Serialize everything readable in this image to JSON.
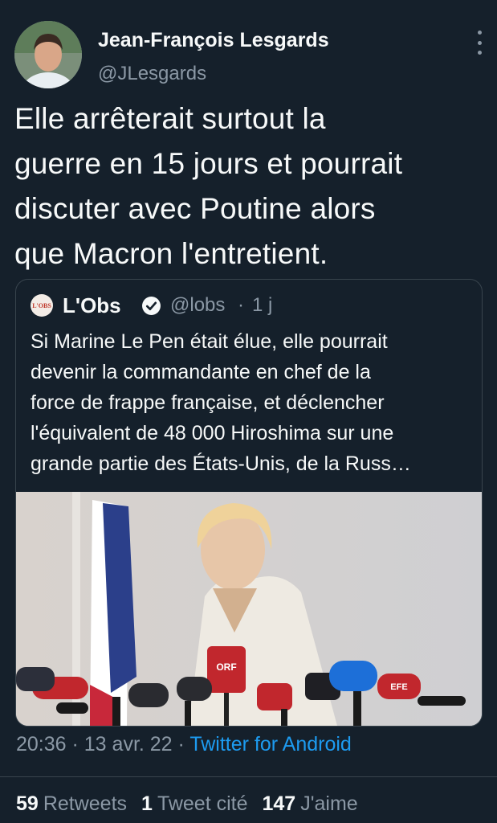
{
  "author": {
    "name": "Jean-François Lesgards",
    "handle": "@JLesgards"
  },
  "tweet": {
    "text": "Elle arrêterait surtout la\nguerre en 15 jours et pourrait\ndiscuter avec Poutine alors\nque Macron l'entretient."
  },
  "quoted": {
    "logo_text": "L'OBS",
    "name": "L'Obs",
    "handle": "@lobs",
    "separator": "·",
    "time": "1 j",
    "text": "Si Marine Le Pen était élue, elle pourrait\ndevenir la commandante en chef de la\nforce de frappe française, et déclencher\nl'équivalent de 48 000 Hiroshima sur une\ngrande partie des États-Unis, de la Russ…",
    "photo_mic_labels": [
      "ORF",
      "EFE"
    ]
  },
  "meta": {
    "time": "20:36",
    "sep1": " · ",
    "date": "13 avr. 22",
    "sep2": " · ",
    "source": "Twitter for Android"
  },
  "stats": {
    "retweets_count": "59",
    "retweets_label": "Retweets",
    "quotes_count": "1",
    "quotes_label": "Tweet cité",
    "likes_count": "147",
    "likes_label": "J'aime"
  },
  "colors": {
    "background": "#15202b",
    "text": "#f7f9f9",
    "muted": "#8b98a5",
    "accent": "#1d9bf0",
    "border": "#38444d"
  },
  "icons": [
    "more-vertical-icon",
    "verified-badge-icon"
  ]
}
